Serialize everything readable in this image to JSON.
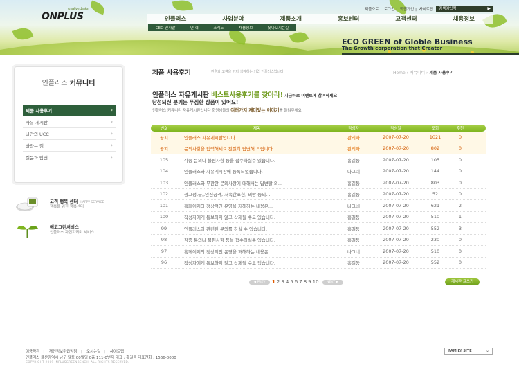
{
  "header": {
    "logo": "ONPLUS",
    "logo_tagline": "creative design",
    "toplinks": [
      "제품으로",
      "로그인",
      "회원가입",
      "사이트맵"
    ],
    "search_label": "검색어입력",
    "gnb": [
      "인플러스",
      "사업분야",
      "제품소개",
      "홍보센터",
      "고객센터",
      "채용정보"
    ],
    "lnb": [
      "CEO 인사말",
      "연 혁",
      "조직도",
      "채용정보",
      "찾아오시는길"
    ],
    "slogan": "ECO GREEN of Globle Business",
    "slogan_sub": "The Growth corporation that Creator"
  },
  "sidebar": {
    "title_a": "인플러스",
    "title_b": "커뮤니티",
    "items": [
      {
        "label": "제품 사용후기",
        "active": true
      },
      {
        "label": "자유 게시판",
        "active": false
      },
      {
        "label": "나만의 UCC",
        "active": false
      },
      {
        "label": "바라는 점",
        "active": false
      },
      {
        "label": "질문과 답변",
        "active": false
      }
    ],
    "promo1": {
      "title": "고객 행복 센터",
      "eng": "HAPPY SERVICE",
      "desc": "행복을 위한 행복센터"
    },
    "promo2": {
      "title": "에코그린서비스",
      "desc": "인플러스 자연지키미 서비스"
    }
  },
  "content": {
    "page_title": "제품 사용후기",
    "page_desc": "환경과 고객을 먼저 생각하는 기업 인플러스입니다",
    "breadcrumb": [
      "Home",
      "커뮤니티",
      "제품 사용후기"
    ],
    "intro1_a": "인플러스 자유게시판 ",
    "intro1_hl": "베스트사용후기를 찾아라!",
    "intro1_small": " 지금바로 이벤트에 참여하세요",
    "intro2": "당첨되신 분께는 푸짐한 상품이 있어요!",
    "intro3_a": "인플러스 커뮤니티 자유게시판입니다 회원님들의 ",
    "intro3_b": "여러가지 재미있는 이야기",
    "intro3_c": "를 들려주세요"
  },
  "table": {
    "headers": [
      "번호",
      "제목",
      "작성자",
      "작성일",
      "조회",
      "추천"
    ],
    "rows": [
      {
        "no": "공지",
        "title": "인플러스 자유게시판입니다.",
        "author": "관리자",
        "date": "2007-07-20",
        "views": "1021",
        "rec": "0",
        "notice": true
      },
      {
        "no": "공지",
        "title": "문의사항을 입력해세요.친절히 답변해 드립니다.",
        "author": "관리자",
        "date": "2007-07-20",
        "views": "802",
        "rec": "0",
        "notice": true
      },
      {
        "no": "105",
        "title": "각종 문의나 불편사항 등을 접수하실수 있습니다.",
        "author": "홍길동",
        "date": "2007-07-20",
        "views": "105",
        "rec": "0"
      },
      {
        "no": "104",
        "title": "인플러스와 자유게시판에 등록되었습니다.",
        "author": "나그네",
        "date": "2007-07-20",
        "views": "144",
        "rec": "0"
      },
      {
        "no": "103",
        "title": "인플러스와 무관한 문의사항에 대해서는 답변할 의...",
        "author": "홍길동",
        "date": "2007-07-20",
        "views": "803",
        "rec": "0"
      },
      {
        "no": "102",
        "title": "광고성,글,,인신공격, 저속한표현, 비방 등의...",
        "author": "홍길동",
        "date": "2007-07-20",
        "views": "52",
        "rec": "0"
      },
      {
        "no": "101",
        "title": "홈페이지의 정상적인 운영을 저해하는 내용은...",
        "author": "나그네",
        "date": "2007-07-20",
        "views": "621",
        "rec": "2"
      },
      {
        "no": "100",
        "title": "작성자에게 통보하지 않고 삭제될 수도 있습니다.",
        "author": "홍길동",
        "date": "2007-07-20",
        "views": "510",
        "rec": "1"
      },
      {
        "no": "99",
        "title": "인플러스와 관련된 문의를 하실 수 있습니다.",
        "author": "홍길동",
        "date": "2007-07-20",
        "views": "552",
        "rec": "3"
      },
      {
        "no": "98",
        "title": "각종 문의나 불편사항 등을 접수하실수 있습니다.",
        "author": "홍길동",
        "date": "2007-07-20",
        "views": "230",
        "rec": "0"
      },
      {
        "no": "97",
        "title": "홈페이지의 정상적인 운영을 저해하는 내용은...",
        "author": "나그네",
        "date": "2007-07-20",
        "views": "510",
        "rec": "0"
      },
      {
        "no": "96",
        "title": "작성자에게 통보하지 않고 삭제될 수도 있습니다.",
        "author": "홍길동",
        "date": "2007-07-20",
        "views": "552",
        "rec": "0"
      }
    ]
  },
  "pager": {
    "prev": "PREV",
    "next": "NEXT",
    "pages": [
      "1",
      "2",
      "3",
      "4",
      "5",
      "6",
      "7",
      "8",
      "9",
      "10"
    ],
    "current": "1"
  },
  "write_button": "게시판 글쓰기",
  "footer": {
    "links": [
      "이용약관",
      "개인정보취급방침",
      "오시는길",
      "사이트맵"
    ],
    "address": "인플러스 울산광역시 남구 달동 00빌딩 0층 111-0번지    대표 : 홍길동  대표전화 : 1566-0000",
    "copyright": "COPYRIGHT 2009 INPLUSGREENBENCH. ALL RIGHTS RESERVED.",
    "family_site": "FAMILY SITE"
  },
  "colors": {
    "accent_green": "#7fb51f",
    "dark_green": "#2e5f3b",
    "notice_orange": "#d35a00"
  }
}
